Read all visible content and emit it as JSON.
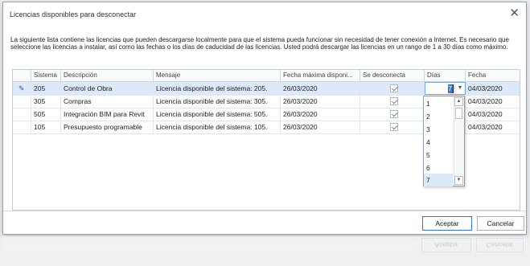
{
  "dialog": {
    "title": "Licencias disponibles para desconectar",
    "description": "La siguiente lista contiene las licencias que pueden descargarse localmente para que el sistema pueda funcionar sin necesidad de tener conexión a Internet. Es necesario que seleccione las licencias a instalar, así como las fechas o los días de caducidad de las licencias. Usted podrá descargar las licencias en un rango de 1 a 30 días como máximo."
  },
  "grid": {
    "columns": [
      "Sistema",
      "Descripción",
      "Mensaje",
      "Fecha máxima disponi...",
      "Se desconecta",
      "Días",
      "Fecha"
    ],
    "rows": [
      {
        "sistema": "205",
        "descripcion": "Control de Obra",
        "mensaje": "Licencia disponible del sistema: 205.",
        "fecha_max": "26/03/2020",
        "desconecta": true,
        "dias": "7",
        "fecha": "04/03/2020"
      },
      {
        "sistema": "305",
        "descripcion": "Compras",
        "mensaje": "Licencia disponible del sistema: 305.",
        "fecha_max": "26/03/2020",
        "desconecta": true,
        "dias": "",
        "fecha": "04/03/2020"
      },
      {
        "sistema": "505",
        "descripcion": "Integración BIM para Revit",
        "mensaje": "Licencia disponible del sistema: 505.",
        "fecha_max": "26/03/2020",
        "desconecta": true,
        "dias": "",
        "fecha": "04/03/2020"
      },
      {
        "sistema": "105",
        "descripcion": "Presupuesto programable",
        "mensaje": "Licencia disponible del sistema: 105.",
        "fecha_max": "26/03/2020",
        "desconecta": true,
        "dias": "",
        "fecha": "04/03/2020"
      }
    ]
  },
  "days_dropdown": {
    "options": [
      "1",
      "2",
      "3",
      "4",
      "5",
      "6",
      "7"
    ],
    "selected": "7"
  },
  "buttons": {
    "accept": "Aceptar",
    "cancel": "Cancelar"
  },
  "icons": {
    "edit_row": "pencil-icon",
    "close": "close-icon",
    "dropdown": "chevron-down-icon"
  },
  "colors": {
    "selection": "#dbe9f8",
    "accent": "#3a78c9"
  }
}
